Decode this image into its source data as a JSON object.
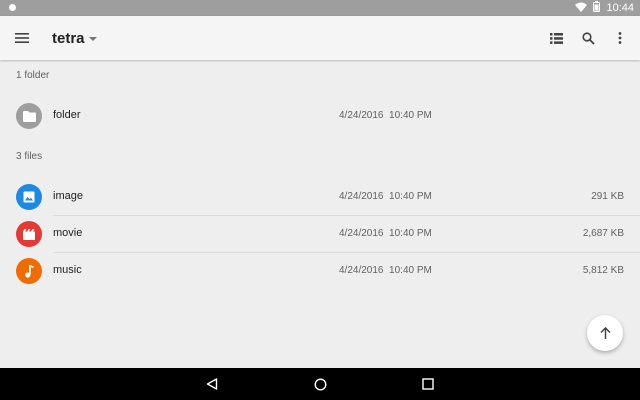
{
  "status_bar": {
    "time": "10:44"
  },
  "toolbar": {
    "title": "tetra"
  },
  "sections": {
    "folders_header": "1 folder",
    "files_header": "3 files"
  },
  "folders": [
    {
      "name": "folder",
      "date": "4/24/2016  10:40 PM",
      "icon": "folder-icon",
      "color": "#9e9e9e"
    }
  ],
  "files": [
    {
      "name": "image",
      "date": "4/24/2016  10:40 PM",
      "size": "291 KB",
      "icon": "image-icon",
      "color": "#1e88e5"
    },
    {
      "name": "movie",
      "date": "4/24/2016  10:40 PM",
      "size": "2,687 KB",
      "icon": "movie-icon",
      "color": "#e53935"
    },
    {
      "name": "music",
      "date": "4/24/2016  10:40 PM",
      "size": "5,812 KB",
      "icon": "music-icon",
      "color": "#ef6c00"
    }
  ],
  "colors": {
    "status_bar": "#9e9e9e",
    "toolbar": "#f5f5f5",
    "background": "#eeeeee",
    "nav_bar": "#000000"
  }
}
